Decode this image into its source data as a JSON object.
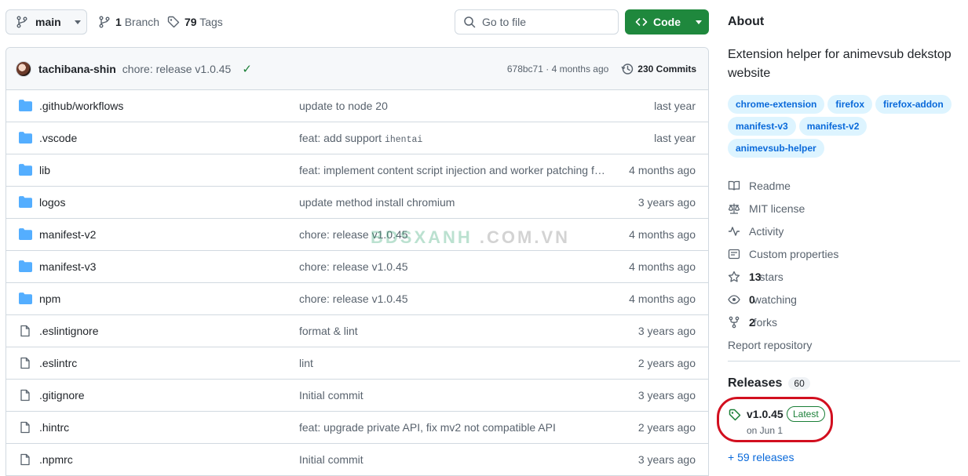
{
  "toolbar": {
    "branch": "main",
    "branches_count": "1",
    "branches_label": "Branch",
    "tags_count": "79",
    "tags_label": "Tags",
    "search_placeholder": "Go to file",
    "code_label": "Code",
    "accent_color": "#1f883d"
  },
  "latest_commit": {
    "author": "tachibana-shin",
    "message": "chore: release v1.0.45",
    "status_icon": "check-icon",
    "hash": "678bc71",
    "age": "4 months ago",
    "separator": "·",
    "commits_count": "230 Commits"
  },
  "files": [
    {
      "type": "folder",
      "name": ".github/workflows",
      "message": "update to node 20",
      "date": "last year"
    },
    {
      "type": "folder",
      "name": ".vscode",
      "message": "feat: add support ",
      "code": "ihentai",
      "date": "last year"
    },
    {
      "type": "folder",
      "name": "lib",
      "message": "feat: implement content script injection and worker patching for Fire…",
      "date": "4 months ago"
    },
    {
      "type": "folder",
      "name": "logos",
      "message": "update method install chromium",
      "date": "3 years ago"
    },
    {
      "type": "folder",
      "name": "manifest-v2",
      "message": "chore: release v1.0.45",
      "date": "4 months ago"
    },
    {
      "type": "folder",
      "name": "manifest-v3",
      "message": "chore: release v1.0.45",
      "date": "4 months ago"
    },
    {
      "type": "folder",
      "name": "npm",
      "message": "chore: release v1.0.45",
      "date": "4 months ago"
    },
    {
      "type": "file",
      "name": ".eslintignore",
      "message": "format & lint",
      "date": "3 years ago"
    },
    {
      "type": "file",
      "name": ".eslintrc",
      "message": "lint",
      "date": "2 years ago"
    },
    {
      "type": "file",
      "name": ".gitignore",
      "message": "Initial commit",
      "date": "3 years ago"
    },
    {
      "type": "file",
      "name": ".hintrc",
      "message": "feat: upgrade private API, fix mv2 not compatible API",
      "date": "2 years ago"
    },
    {
      "type": "file",
      "name": ".npmrc",
      "message": "Initial commit",
      "date": "3 years ago"
    }
  ],
  "watermark": {
    "part1": "BDSXANH",
    "part2": ".COM.VN"
  },
  "about": {
    "title": "About",
    "description": "Extension helper for animevsub dekstop website",
    "topics": [
      "chrome-extension",
      "firefox",
      "firefox-addon",
      "manifest-v3",
      "manifest-v2",
      "animevsub-helper"
    ],
    "meta": [
      {
        "icon": "book-icon",
        "label": "Readme"
      },
      {
        "icon": "law-icon",
        "label": "MIT license"
      },
      {
        "icon": "pulse-icon",
        "label": "Activity"
      },
      {
        "icon": "note-icon",
        "label": "Custom properties"
      },
      {
        "icon": "star-icon",
        "count": "13",
        "label": "stars"
      },
      {
        "icon": "eye-icon",
        "count": "0",
        "label": "watching"
      },
      {
        "icon": "fork-icon",
        "count": "2",
        "label": "forks"
      }
    ],
    "report": "Report repository"
  },
  "releases": {
    "title": "Releases",
    "count": "60",
    "latest_version": "v1.0.45",
    "latest_badge": "Latest",
    "latest_date": "on Jun 1",
    "more": "+ 59 releases",
    "highlight_color": "#d20f1f"
  }
}
